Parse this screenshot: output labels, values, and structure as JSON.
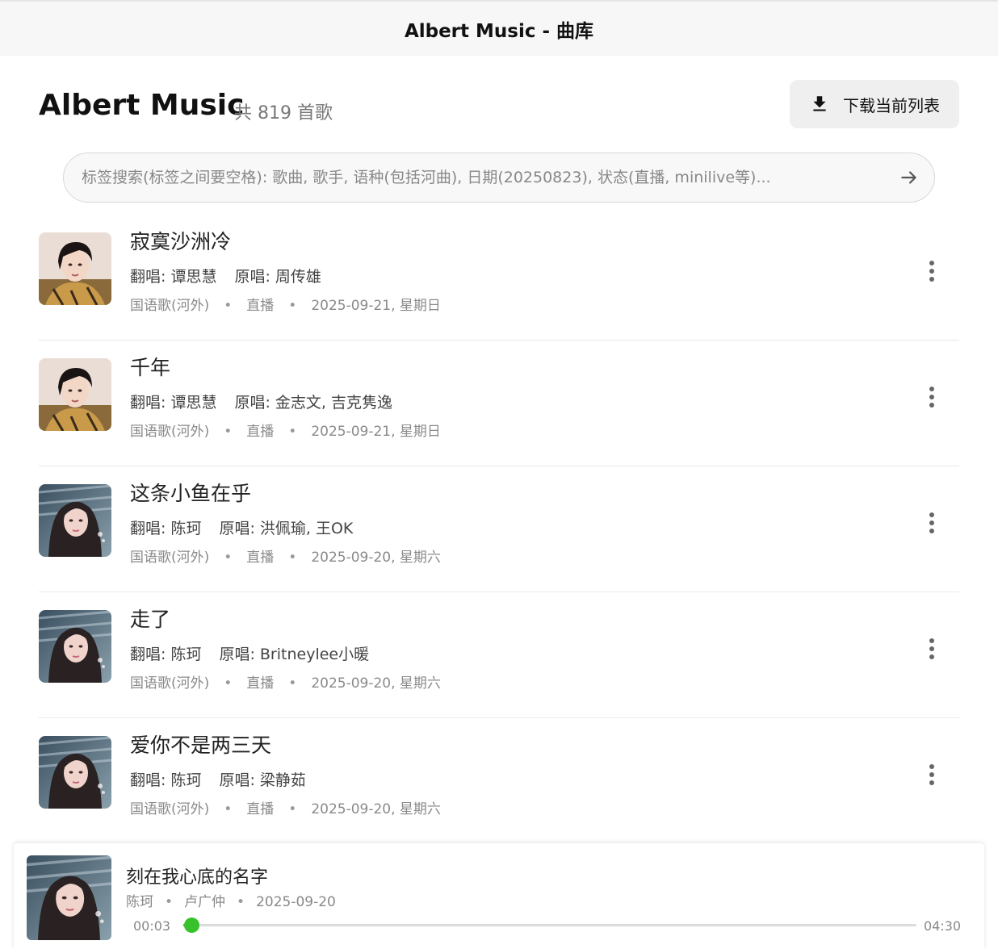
{
  "window": {
    "title": "Albert Music - 曲库"
  },
  "header": {
    "title": "Albert Music",
    "count": "共 819 首歌",
    "download_label": "下载当前列表"
  },
  "search": {
    "placeholder": "标签搜索(标签之间要空格): 歌曲, 歌手, 语种(包括河曲), 日期(20250823), 状态(直播, minilive等)...",
    "value": ""
  },
  "songs": [
    {
      "title": "寂寞沙洲冷",
      "cover_artist": "翻唱: 谭思慧",
      "original_artist": "原唱: 周传雄",
      "language": "国语歌(河外)",
      "status": "直播",
      "date": "2025-09-21, 星期日",
      "avatar": "avatar-a"
    },
    {
      "title": "千年",
      "cover_artist": "翻唱: 谭思慧",
      "original_artist": "原唱: 金志文, 吉克隽逸",
      "language": "国语歌(河外)",
      "status": "直播",
      "date": "2025-09-21, 星期日",
      "avatar": "avatar-a"
    },
    {
      "title": "这条小鱼在乎",
      "cover_artist": "翻唱: 陈珂",
      "original_artist": "原唱: 洪佩瑜, 王OK",
      "language": "国语歌(河外)",
      "status": "直播",
      "date": "2025-09-20, 星期六",
      "avatar": "avatar-b"
    },
    {
      "title": "走了",
      "cover_artist": "翻唱: 陈珂",
      "original_artist": "原唱: Britneylee小暖",
      "language": "国语歌(河外)",
      "status": "直播",
      "date": "2025-09-20, 星期六",
      "avatar": "avatar-b"
    },
    {
      "title": "爱你不是两三天",
      "cover_artist": "翻唱: 陈珂",
      "original_artist": "原唱: 梁静茹",
      "language": "国语歌(河外)",
      "status": "直播",
      "date": "2025-09-20, 星期六",
      "avatar": "avatar-b"
    }
  ],
  "player": {
    "title": "刻在我心底的名字",
    "artist": "陈珂",
    "original": "卢广仲",
    "date": "2025-09-20",
    "current_time": "00:03",
    "total_time": "04:30",
    "progress": 0.011,
    "accent_color": "#37c22b"
  },
  "icons": {
    "download": "download-icon",
    "search_submit": "arrow-right-icon",
    "more": "more-vertical-icon"
  }
}
